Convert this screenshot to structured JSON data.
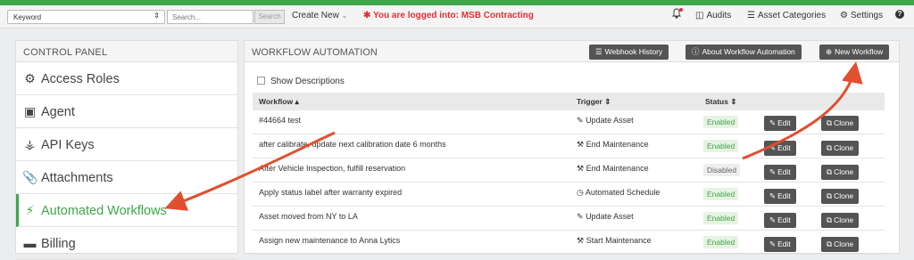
{
  "topbar": {
    "keyword_select": "Keyword",
    "search_placeholder": "Search...",
    "search_button": "Search",
    "create_new": "Create New",
    "logged_in_message": "You are logged into: MSB Contracting",
    "nav": [
      {
        "label": "Audits",
        "icon": "audits-icon"
      },
      {
        "label": "Asset Categories",
        "icon": "categories-icon"
      },
      {
        "label": "Settings",
        "icon": "gear-icon"
      }
    ],
    "help": "?"
  },
  "control_panel": {
    "title": "CONTROL PANEL",
    "items": [
      {
        "label": "Access Roles",
        "icon": "accessibility-icon"
      },
      {
        "label": "Agent",
        "icon": "monitor-icon"
      },
      {
        "label": "API Keys",
        "icon": "key-icon"
      },
      {
        "label": "Attachments",
        "icon": "paperclip-icon"
      },
      {
        "label": "Automated Workflows",
        "icon": "bolt-icon",
        "active": true
      },
      {
        "label": "Billing",
        "icon": "credit-card-icon"
      }
    ]
  },
  "workflow": {
    "title": "WORKFLOW AUTOMATION",
    "webhook_button": "Webhook History",
    "about_button": "About Workflow Automation",
    "new_button": "New Workflow",
    "show_descriptions": "Show Descriptions",
    "columns": {
      "workflow": "Workflow",
      "trigger": "Trigger",
      "status": "Status"
    },
    "edit_label": "Edit",
    "clone_label": "Clone",
    "rows": [
      {
        "name": "#44664 test",
        "trigger": "Update Asset",
        "trigger_icon": "edit-icon",
        "status": "Enabled"
      },
      {
        "name": "after calibrate, update next calibration date 6 months",
        "trigger": "End Maintenance",
        "trigger_icon": "wrench-icon",
        "status": "Enabled"
      },
      {
        "name": "After Vehicle Inspection, fulfill reservation",
        "trigger": "End Maintenance",
        "trigger_icon": "wrench-icon",
        "status": "Disabled"
      },
      {
        "name": "Apply status label after warranty expired",
        "trigger": "Automated Schedule",
        "trigger_icon": "clock-icon",
        "status": "Enabled"
      },
      {
        "name": "Asset moved from NY to LA",
        "trigger": "Update Asset",
        "trigger_icon": "edit-icon",
        "status": "Enabled"
      },
      {
        "name": "Assign new maintenance to Anna Lytics",
        "trigger": "Start Maintenance",
        "trigger_icon": "wrench-icon",
        "status": "Enabled"
      }
    ]
  },
  "colors": {
    "accent": "#3fa64a",
    "alert": "#e03030",
    "annotation_arrow": "#e0502e",
    "button": "#545454"
  }
}
